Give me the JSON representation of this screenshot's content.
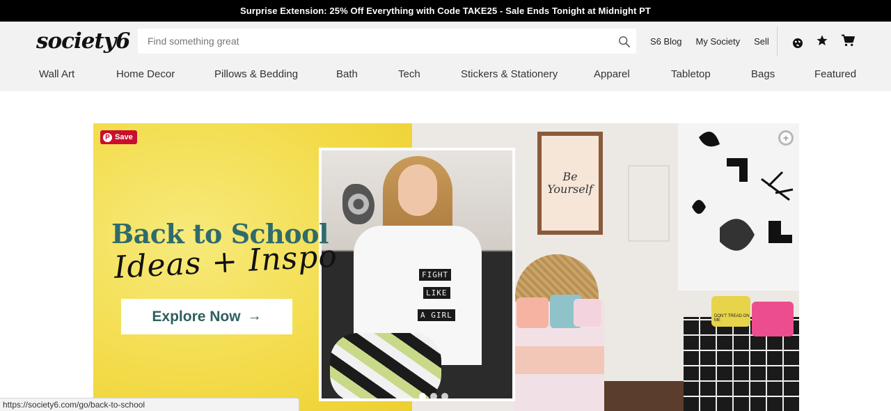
{
  "promo": {
    "text": "Surprise Extension: 25% Off Everything with Code TAKE25 - Sale Ends Tonight at Midnight PT"
  },
  "header": {
    "logo": "society6",
    "search": {
      "placeholder": "Find something great",
      "value": ""
    },
    "links": {
      "blog": "S6 Blog",
      "my_society": "My Society",
      "sell": "Sell"
    },
    "icons": {
      "account": "globe-icon",
      "wishlist": "star-icon",
      "cart": "cart-icon"
    }
  },
  "nav": {
    "items": [
      "Wall Art",
      "Home Decor",
      "Pillows & Bedding",
      "Bath",
      "Tech",
      "Stickers & Stationery",
      "Apparel",
      "Tabletop",
      "Bags",
      "Featured"
    ]
  },
  "hero": {
    "title": "Back to School",
    "script": "Ideas + Inspo",
    "cta": "Explore Now",
    "cta_arrow": "→",
    "pin_label": "Save",
    "zoom_icon": "zoom-plus-icon",
    "frame_text": "Be Yourself",
    "shirt_lines": [
      "FIGHT",
      "LIKE",
      "A GIRL"
    ],
    "pillow_text": "DON'T TREAD ON ME",
    "colors": {
      "yellow": "#f3dc4c",
      "teal": "#2f6b6b",
      "pinterest": "#c8102e"
    }
  },
  "status_bar": {
    "url": "https://society6.com/go/back-to-school"
  }
}
